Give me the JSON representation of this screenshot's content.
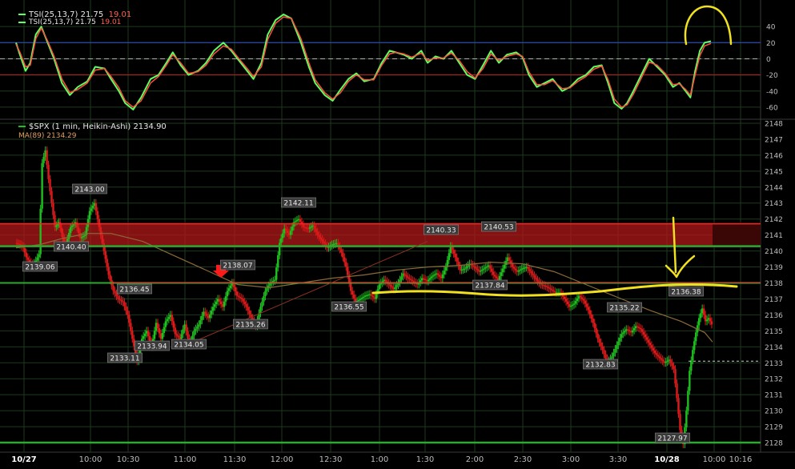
{
  "colors": {
    "background": "#000000",
    "grid": "#1c3a1c",
    "candle_up": "#1fbf1f",
    "candle_down": "#e01a1a",
    "ma_line": "#8a6a3a",
    "tsi_line": "#60ff60",
    "tsi_signal": "#ff5040",
    "level_green": "#2ea82e",
    "resistance_zone": "#b01818",
    "annotation_yellow": "#f0e020"
  },
  "tsi_legend": {
    "label1": "TSI(25,13,7)",
    "val1a": "21.75",
    "val1b": "19.01",
    "label2": "TSI(25,13,7)",
    "val2a": "21.75",
    "val2b": "19.01"
  },
  "price_legend": {
    "symbol": "$SPX (1 min, Heikin-Ashi)",
    "last": "2134.90",
    "ma_label": "MA(89)",
    "ma_value": "2134.29"
  },
  "chart_data": [
    {
      "type": "line",
      "title": "TSI(25,13,7)",
      "ylim": [
        -70,
        60
      ],
      "y_ticks": [
        40,
        20,
        0,
        -20,
        -40,
        -60
      ],
      "reference_lines": [
        20,
        0,
        -20
      ],
      "x": [
        0,
        5,
        12,
        18,
        25,
        32,
        40,
        48,
        58,
        68,
        78,
        90,
        100,
        112,
        120,
        130,
        138,
        148,
        158,
        170,
        180,
        190,
        198,
        208,
        218,
        230,
        240,
        250,
        262,
        272,
        280,
        292,
        300,
        310,
        318,
        328,
        338,
        348,
        360,
        370,
        378,
        390,
        400,
        410,
        420,
        430,
        440,
        452,
        462,
        472,
        480,
        490,
        500,
        512,
        520,
        530,
        540,
        550,
        560,
        570,
        580,
        590,
        600,
        610,
        620,
        632,
        640,
        648,
        658,
        668,
        678,
        690,
        700,
        710,
        720,
        730,
        740,
        748,
        756,
        765,
        772,
        780,
        790,
        800,
        810,
        820,
        830,
        838,
        846,
        852,
        858,
        864,
        870,
        878
      ],
      "series": [
        {
          "values": [
            20,
            5,
            -15,
            -5,
            30,
            40,
            20,
            0,
            -30,
            -45,
            -35,
            -28,
            -10,
            -12,
            -25,
            -40,
            -55,
            -63,
            -48,
            -25,
            -20,
            -5,
            8,
            -8,
            -20,
            -15,
            -5,
            10,
            20,
            10,
            0,
            -15,
            -25,
            -5,
            30,
            48,
            55,
            50,
            20,
            -10,
            -30,
            -45,
            -52,
            -38,
            -25,
            -18,
            -28,
            -25,
            -5,
            10,
            8,
            5,
            0,
            10,
            -5,
            3,
            0,
            10,
            -5,
            -20,
            -25,
            -8,
            10,
            -5,
            5,
            8,
            2,
            -20,
            -35,
            -30,
            -25,
            -40,
            -35,
            -25,
            -20,
            -10,
            -8,
            -30,
            -55,
            -62,
            -55,
            -40,
            -20,
            0,
            -10,
            -20,
            -35,
            -30,
            -40,
            -48,
            -15,
            10,
            20,
            21.75
          ]
        },
        {
          "values": [
            18,
            8,
            -10,
            -8,
            25,
            38,
            22,
            3,
            -25,
            -42,
            -38,
            -30,
            -14,
            -12,
            -22,
            -36,
            -52,
            -60,
            -52,
            -30,
            -22,
            -8,
            5,
            -5,
            -18,
            -16,
            -8,
            6,
            16,
            12,
            2,
            -12,
            -22,
            -10,
            24,
            44,
            52,
            50,
            25,
            -5,
            -26,
            -42,
            -50,
            -42,
            -28,
            -20,
            -26,
            -26,
            -8,
            6,
            8,
            6,
            2,
            7,
            -2,
            1,
            1,
            7,
            -2,
            -16,
            -24,
            -12,
            6,
            -2,
            3,
            6,
            3,
            -16,
            -32,
            -32,
            -27,
            -37,
            -36,
            -28,
            -22,
            -13,
            -9,
            -26,
            -50,
            -60,
            -57,
            -44,
            -24,
            -4,
            -8,
            -18,
            -32,
            -31,
            -38,
            -45,
            -20,
            4,
            16,
            19.01
          ]
        }
      ]
    },
    {
      "type": "candlestick",
      "title": "$SPX (1 min, Heikin-Ashi)",
      "ylim": [
        2127.5,
        2148.2
      ],
      "y_ticks": [
        2148,
        2147,
        2146,
        2145,
        2144,
        2143,
        2142,
        2141,
        2140,
        2139,
        2138,
        2137,
        2136,
        2135,
        2134,
        2133,
        2132,
        2131,
        2130,
        2129,
        2128
      ],
      "x_ticks": [
        "10/27",
        "10:00",
        "10:30",
        "11:00",
        "11:30",
        "12:00",
        "12:30",
        "1:00",
        "1:30",
        "2:00",
        "2:30",
        "3:00",
        "3:30",
        "10/28",
        "10:00",
        "10:16"
      ],
      "levels": {
        "resistance_zone": [
          2140.3,
          2141.7
        ],
        "green_level_1": 2140.3,
        "green_level_2": 2138.0,
        "green_level_3": 2128.0,
        "dashed_last": 2133.1
      },
      "labels": [
        "2143.00",
        "2140.40",
        "2139.06",
        "2136.45",
        "2133.11",
        "2133.94",
        "2134.05",
        "2138.07",
        "2135.26",
        "2142.11",
        "2136.55",
        "2140.33",
        "2137.84",
        "2140.53",
        "2135.22",
        "2132.83",
        "2136.38",
        "2127.97"
      ],
      "close_path_x": [
        0,
        6,
        10,
        14,
        18,
        22,
        26,
        30,
        34,
        38,
        42,
        46,
        50,
        55,
        60,
        64,
        70,
        76,
        82,
        88,
        94,
        100,
        106,
        112,
        118,
        124,
        130,
        136,
        142,
        148,
        154,
        160,
        166,
        172,
        178,
        184,
        190,
        196,
        202,
        208,
        214,
        220,
        226,
        232,
        238,
        244,
        250,
        256,
        262,
        268,
        274,
        280,
        286,
        292,
        298,
        304,
        310,
        316,
        322,
        328,
        334,
        340,
        346,
        352,
        358,
        364,
        370,
        376,
        382,
        388,
        394,
        400,
        406,
        412,
        418,
        424,
        430,
        436,
        442,
        448,
        454,
        460,
        466,
        472,
        478,
        484,
        490,
        496,
        502,
        508,
        514,
        520,
        526,
        532,
        538,
        544,
        550,
        556,
        562,
        568,
        574,
        580,
        586,
        592,
        598,
        604,
        610,
        616,
        622,
        628,
        634,
        640,
        646,
        652,
        658,
        664,
        670,
        676,
        682,
        688,
        694,
        700,
        706,
        712,
        718,
        724,
        730,
        736,
        742,
        748,
        754,
        760,
        766,
        772,
        778,
        784,
        790,
        796,
        802,
        808,
        814,
        820,
        826,
        832,
        836,
        840,
        844,
        848,
        852,
        856,
        860,
        864,
        868,
        872,
        876,
        880
      ],
      "close_path_y": [
        2140.5,
        2140.4,
        2140.2,
        2139.6,
        2139.3,
        2139.1,
        2139.4,
        2139.8,
        2145.5,
        2146.3,
        2144.5,
        2143.0,
        2141.5,
        2141.8,
        2140.8,
        2140.4,
        2141.5,
        2141.8,
        2140.8,
        2141.0,
        2142.5,
        2143.0,
        2141.5,
        2140.0,
        2138.5,
        2137.5,
        2137.0,
        2136.8,
        2136.0,
        2134.5,
        2133.1,
        2134.5,
        2135.0,
        2134.0,
        2135.5,
        2134.5,
        2135.6,
        2136.0,
        2134.8,
        2134.5,
        2135.4,
        2134.1,
        2135.0,
        2135.4,
        2136.2,
        2135.8,
        2136.5,
        2137.0,
        2136.5,
        2137.5,
        2138.0,
        2137.2,
        2137.0,
        2136.5,
        2135.8,
        2135.3,
        2136.5,
        2137.5,
        2138.0,
        2138.2,
        2140.5,
        2141.4,
        2141.0,
        2141.8,
        2142.0,
        2141.5,
        2141.4,
        2141.6,
        2141.0,
        2140.6,
        2140.2,
        2140.4,
        2140.5,
        2139.9,
        2139.0,
        2137.5,
        2136.8,
        2137.0,
        2137.2,
        2137.3,
        2137.0,
        2137.9,
        2138.2,
        2137.9,
        2137.6,
        2138.0,
        2138.6,
        2138.3,
        2138.1,
        2137.9,
        2138.3,
        2138.1,
        2138.4,
        2138.6,
        2138.3,
        2139.0,
        2140.3,
        2139.6,
        2138.8,
        2138.9,
        2139.2,
        2139.0,
        2138.7,
        2138.9,
        2139.1,
        2138.5,
        2138.2,
        2138.9,
        2139.6,
        2139.0,
        2138.7,
        2138.9,
        2139.0,
        2138.6,
        2138.2,
        2137.9,
        2137.8,
        2137.6,
        2137.4,
        2137.4,
        2137.0,
        2136.5,
        2136.7,
        2137.2,
        2136.9,
        2136.3,
        2135.5,
        2134.5,
        2133.8,
        2133.0,
        2133.4,
        2134.1,
        2134.8,
        2135.1,
        2134.9,
        2135.3,
        2135.1,
        2134.6,
        2134.1,
        2133.6,
        2133.3,
        2133.0,
        2133.2,
        2132.6,
        2130.8,
        2128.8,
        2127.9,
        2130.0,
        2132.5,
        2133.8,
        2134.9,
        2135.8,
        2136.4,
        2135.6,
        2135.8,
        2135.4,
        2134.9
      ],
      "ma_x": [
        0,
        30,
        60,
        90,
        120,
        160,
        200,
        240,
        280,
        320,
        360,
        400,
        440,
        480,
        520,
        560,
        600,
        640,
        680,
        720,
        760,
        800,
        840,
        870,
        880
      ],
      "ma_y": [
        2140.2,
        2140.4,
        2140.8,
        2141.1,
        2141.1,
        2140.6,
        2139.7,
        2138.8,
        2137.9,
        2137.7,
        2138.0,
        2138.3,
        2138.5,
        2138.8,
        2139.0,
        2139.1,
        2139.3,
        2139.2,
        2138.7,
        2137.9,
        2137.1,
        2136.3,
        2135.6,
        2134.9,
        2134.3
      ]
    }
  ]
}
